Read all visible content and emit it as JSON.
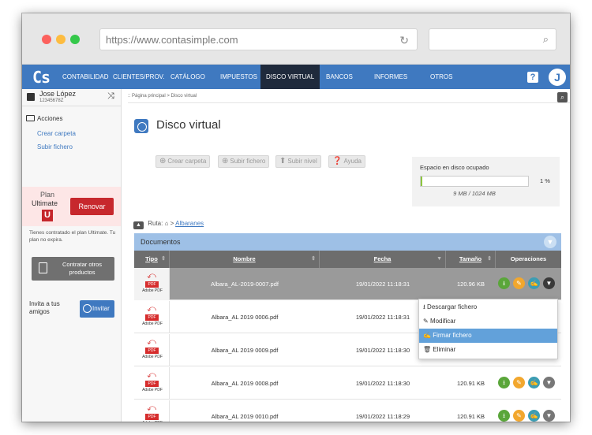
{
  "browser": {
    "url": "https://www.contasimple.com",
    "dots": [
      "#fc615d",
      "#fdbc40",
      "#34c84a"
    ]
  },
  "nav": {
    "logo": "Cs",
    "items": [
      "CONTABILIDAD",
      "CLIENTES/PROV.",
      "CATÁLOGO",
      "IMPUESTOS",
      "DISCO VIRTUAL",
      "BANCOS",
      "INFORMES",
      "OTROS"
    ],
    "active": "DISCO VIRTUAL",
    "help": "?",
    "avatar": "J",
    "accent": "#3f79c0"
  },
  "sidebar": {
    "user_name": "Jose López",
    "user_id": "12345678Z",
    "close": "⤨",
    "actions_title": "Acciones",
    "links": [
      "Crear carpeta",
      "Subir fichero"
    ],
    "plan_label": "Plan",
    "plan_name": "Ultimate",
    "plan_badge": "U",
    "renew_label": "Renovar",
    "plan_note": "Tienes contratado el plan Ultimate. Tu plan no expira.",
    "contract_label": "Contratar otros productos",
    "invite_text": "Invita a tus amigos",
    "invite_label": "Invitar"
  },
  "main": {
    "breadcrumb": ":: Página principal > Disco virtual",
    "title": "Disco virtual",
    "toolbar": [
      "Crear carpeta",
      "Subir fichero",
      "Subir nivel",
      "Ayuda"
    ],
    "storage": {
      "label": "Espacio en disco ocupado",
      "percent_text": "1 %",
      "used_fraction": 0.01,
      "detail": "9 MB / 1024 MB"
    },
    "route_label": "Ruta:",
    "route_folder": "Albaranes",
    "documents_title": "Documentos",
    "columns": [
      "Tipo",
      "Nombre",
      "Fecha",
      "Tamaño",
      "Operaciones"
    ],
    "file_type": "PDF",
    "file_type_caption": "Adobe PDF",
    "rows": [
      {
        "name": "Albara_AL-2019-0007.pdf",
        "date": "19/01/2022 11:18:31",
        "size": "120.96 KB"
      },
      {
        "name": "Albara_AL 2019 0006.pdf",
        "date": "19/01/2022 11:18:31",
        "size": "120.96 KB"
      },
      {
        "name": "Albara_AL 2019 0009.pdf",
        "date": "19/01/2022 11:18:30",
        "size": "120.96 KB"
      },
      {
        "name": "Albara_AL 2019 0008.pdf",
        "date": "19/01/2022 11:18:30",
        "size": "120.91 KB"
      },
      {
        "name": "Albara_AL 2019 0010.pdf",
        "date": "19/01/2022 11:18:29",
        "size": "120.91 KB"
      }
    ]
  },
  "context_menu": {
    "items": [
      "Descargar fichero",
      "Modificar",
      "Firmar fichero",
      "Eliminar"
    ],
    "highlighted": "Firmar fichero"
  },
  "op_colors": {
    "download": "#5aa63a",
    "edit": "#f2a72e",
    "sign": "#3c9db3",
    "more": "#3a3a3a"
  }
}
